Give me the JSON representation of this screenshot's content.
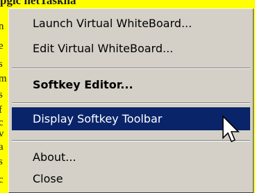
{
  "background": {
    "top_text": "pgic  netTaskha"
  },
  "menu": {
    "items": [
      {
        "label": "Launch Virtual WhiteBoard..."
      },
      {
        "label": "Edit Virtual WhiteBoard..."
      },
      {
        "label": "Softkey Editor..."
      },
      {
        "label": "Display Softkey Toolbar"
      },
      {
        "label": "About..."
      },
      {
        "label": "Close"
      }
    ],
    "highlighted_item": "Display Softkey Toolbar"
  },
  "colors": {
    "page_background": "#ffff00",
    "menu_background": "#d4d0c8",
    "highlight": "#0a246a"
  },
  "icons": {
    "cursor": "mouse-pointer-icon"
  }
}
